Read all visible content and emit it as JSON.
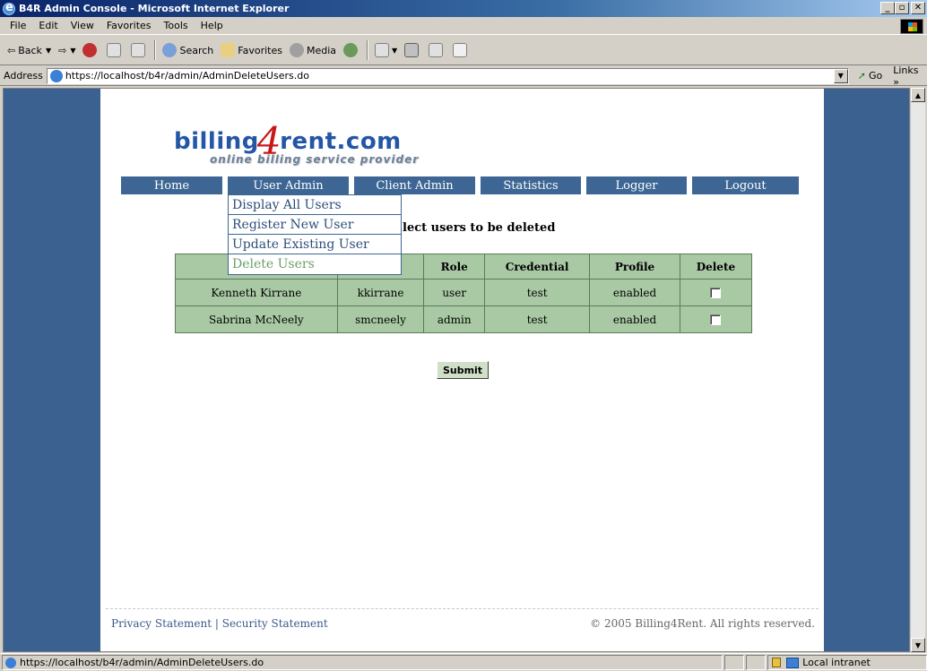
{
  "window": {
    "title": "B4R Admin Console - Microsoft Internet Explorer"
  },
  "menu": [
    "File",
    "Edit",
    "View",
    "Favorites",
    "Tools",
    "Help"
  ],
  "toolbar": {
    "back": "Back",
    "search": "Search",
    "favorites": "Favorites",
    "media": "Media"
  },
  "address": {
    "label": "Address",
    "url": "https://localhost/b4r/admin/AdminDeleteUsers.do",
    "go": "Go",
    "links": "Links »"
  },
  "logo": {
    "prefix": "billing",
    "digit": "4",
    "suffix": "rent",
    "tld": ".com",
    "tagline": "online billing service provider"
  },
  "nav": [
    "Home",
    "User Admin",
    "Client Admin",
    "Statistics",
    "Logger",
    "Logout"
  ],
  "dropdown": [
    "Display All Users",
    "Register New User",
    "Update Existing User",
    "Delete Users"
  ],
  "instruction": "lect users to be deleted",
  "table": {
    "headers": [
      "",
      "",
      "Role",
      "Credential",
      "Profile",
      "Delete"
    ],
    "rows": [
      [
        "Kenneth Kirrane",
        "kkirrane",
        "user",
        "test",
        "enabled"
      ],
      [
        "Sabrina McNeely",
        "smcneely",
        "admin",
        "test",
        "enabled"
      ]
    ]
  },
  "submit": "Submit",
  "footer": {
    "left": "Privacy Statement | Security Statement",
    "right": "© 2005 Billing4Rent. All rights reserved."
  },
  "status": {
    "url": "https://localhost/b4r/admin/AdminDeleteUsers.do",
    "zone": "Local intranet"
  }
}
